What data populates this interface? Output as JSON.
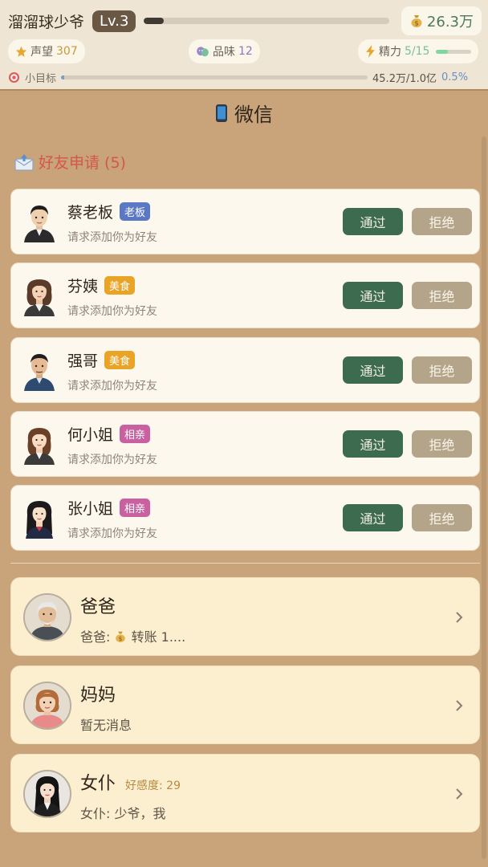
{
  "player": {
    "name": "溜溜球少爷",
    "level": "Lv.3",
    "xp_fraction": 0.08,
    "money": "26.3万"
  },
  "stats": {
    "reputation_label": "声望",
    "reputation_value": "307",
    "taste_label": "品味",
    "taste_value": "12",
    "energy_label": "精力",
    "energy_value": "5/15",
    "energy_fraction": 0.333
  },
  "goal": {
    "label": "小目标",
    "progress": "45.2万/1.0亿",
    "percent": "0.5%",
    "fraction": 0.005
  },
  "page": {
    "title": "微信"
  },
  "requests_section": {
    "title": "好友申请 (5)"
  },
  "friend_requests": [
    {
      "name": "蔡老板",
      "tag": "老板",
      "tag_color": "#5b78c4",
      "subtitle": "请求添加你为好友",
      "accept": "通过",
      "reject": "拒绝"
    },
    {
      "name": "芬姨",
      "tag": "美食",
      "tag_color": "#e9a326",
      "subtitle": "请求添加你为好友",
      "accept": "通过",
      "reject": "拒绝"
    },
    {
      "name": "强哥",
      "tag": "美食",
      "tag_color": "#e9a326",
      "subtitle": "请求添加你为好友",
      "accept": "通过",
      "reject": "拒绝"
    },
    {
      "name": "何小姐",
      "tag": "相亲",
      "tag_color": "#c9609f",
      "subtitle": "请求添加你为好友",
      "accept": "通过",
      "reject": "拒绝"
    },
    {
      "name": "张小姐",
      "tag": "相亲",
      "tag_color": "#c9609f",
      "subtitle": "请求添加你为好友",
      "accept": "通过",
      "reject": "拒绝"
    }
  ],
  "chats": [
    {
      "name": "爸爸",
      "preview_prefix": "爸爸: ",
      "preview_rest": " 转账 1....",
      "has_money_icon": true,
      "favor": ""
    },
    {
      "name": "妈妈",
      "preview_prefix": "暂无消息",
      "preview_rest": "",
      "has_money_icon": false,
      "favor": ""
    },
    {
      "name": "女仆",
      "preview_prefix": "女仆: 少爷，我",
      "preview_rest": "",
      "has_money_icon": false,
      "favor": "好感度: 29"
    }
  ],
  "colors": {
    "accept": "#3d6b4f",
    "reject": "#b3a48a",
    "section_title": "#d4574c",
    "money": "#4d7a5c"
  }
}
